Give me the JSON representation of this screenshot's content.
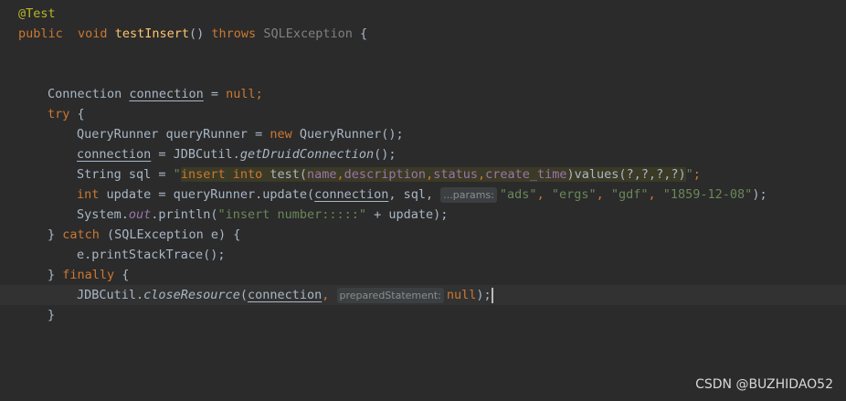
{
  "code": {
    "l1": {
      "annotation": "@Test"
    },
    "l2": {
      "public": "public",
      "void": "void",
      "method": "testInsert",
      "parens": "()",
      "throws": "throws",
      "exception": "SQLException",
      "brace": "{"
    },
    "l5": {
      "type": "Connection",
      "var": "connection",
      "eq": "=",
      "null": "null",
      "semi": ";"
    },
    "l6": {
      "try": "try",
      "brace": "{"
    },
    "l7": {
      "text": "QueryRunner queryRunner = ",
      "new": "new",
      "rest": "QueryRunner();"
    },
    "l8": {
      "var": "connection",
      "mid": " = JDBCutil.",
      "method": "getDruidConnection",
      "rest": "();"
    },
    "l9": {
      "pre": "String sql = ",
      "q1": "\"",
      "insert": "insert into",
      "mid1": " test(",
      "c1": "name",
      "comma1": ",",
      "c2": "description",
      "comma2": ",",
      "c3": "status",
      "comma3": ",",
      "c4": "create_time",
      "mid2": ")values(?,?,?,?)",
      "q2": "\"",
      "semi": ";"
    },
    "l10": {
      "int": "int",
      "pre": " update = queryRunner.update(",
      "var": "connection",
      "mid": ", sql, ",
      "hint": "...params:",
      "a1": "\"ads\"",
      "a2": "\"ergs\"",
      "a3": "\"gdf\"",
      "a4": "\"1859-12-08\"",
      "end": ");"
    },
    "l11": {
      "pre": "System.",
      "out": "out",
      "mid": ".println(",
      "str": "\"insert number:::::\"",
      "end": " + update);"
    },
    "l12": {
      "close": "} ",
      "catch": "catch",
      "rest": " (SQLException e) {"
    },
    "l13": {
      "text": "e.printStackTrace();"
    },
    "l14": {
      "close": "} ",
      "finally": "finally",
      "rest": " {"
    },
    "l15": {
      "pre": "JDBCutil.",
      "method": "closeResource",
      "open": "(",
      "var": "connection",
      "comma": ", ",
      "hint": "preparedStatement:",
      "null": "null",
      "end": ");"
    },
    "l16": {
      "text": "}"
    }
  },
  "watermark": "CSDN @BUZHIDAO52",
  "colors": {
    "background": "#2b2b2b",
    "keyword": "#cc7832",
    "string": "#6a8759",
    "method": "#ffc66d",
    "annotation": "#bbb529",
    "field": "#9876aa"
  }
}
